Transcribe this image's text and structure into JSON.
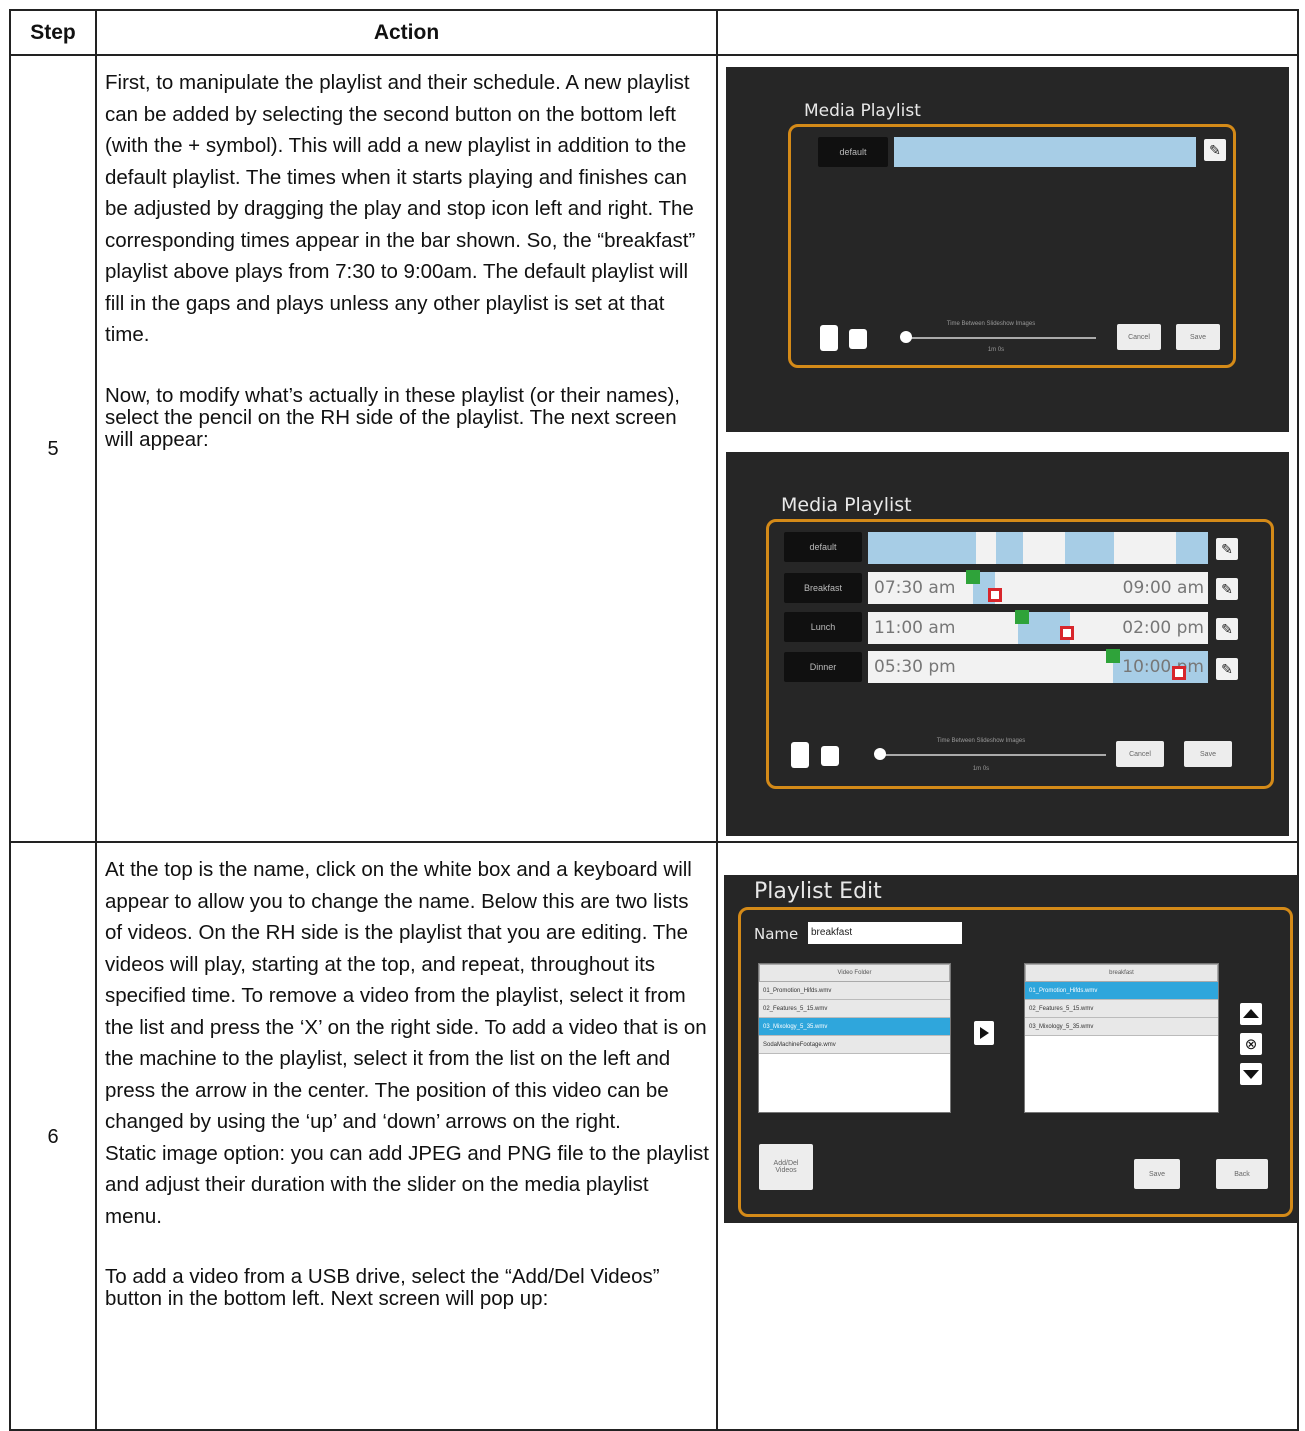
{
  "table": {
    "header": {
      "step": "Step",
      "action": "Action"
    },
    "rows": [
      {
        "step": "5",
        "paragraph1": "First, to manipulate the playlist and their schedule. A new playlist can be added by selecting the second button on the bottom left (with the + symbol). This will add a new playlist in addition to the default playlist. The times when it starts playing and finishes can be adjusted by dragging the play and stop icon left and right. The corresponding times appear in the bar shown. So, the “breakfast” playlist above plays from 7:30 to 9:00am. The default playlist will fill in the gaps and plays unless any other playlist is set at that time.",
        "paragraph2": "Now, to modify what’s actually in these playlist (or their names), select the pencil on the RH side of the playlist. The next screen will appear:"
      },
      {
        "step": "6",
        "paragraph1": "At the top is the name, click on the white box and a keyboard will appear to allow you to change the name. Below this are two lists of videos. On the RH side is the playlist that you are editing. The videos will play, starting at the top, and repeat, throughout its specified time. To remove a video from the playlist, select it from the list and press the ‘X’ on the right side. To add a video that is on the machine to the playlist, select it from the list on the left and press the arrow in the center. The position of this video can be changed by using the ‘up’ and ‘down’ arrows on the right.",
        "paragraph2": "Static image option: you can add JPEG and PNG file to the playlist and adjust their duration with the slider on the media playlist menu.",
        "paragraph3": "To add a video from a USB drive, select the “Add/Del Videos” button in the bottom left. Next screen will pop up:"
      }
    ]
  },
  "shot1": {
    "title": "Media Playlist",
    "default_label": "default",
    "slider_caption": "Time Between Slideshow Images",
    "slider_value": "1m 0s",
    "cancel": "Cancel",
    "save": "Save"
  },
  "shot2": {
    "title": "Media Playlist",
    "rows": [
      {
        "label": "default",
        "start": "",
        "end": ""
      },
      {
        "label": "Breakfast",
        "start": "07:30 am",
        "end": "09:00 am"
      },
      {
        "label": "Lunch",
        "start": "11:00 am",
        "end": "02:00 pm"
      },
      {
        "label": "Dinner",
        "start": "05:30 pm",
        "end": "10:00 pm"
      }
    ],
    "slider_caption": "Time Between Slideshow Images",
    "slider_value": "1m 0s",
    "cancel": "Cancel",
    "save": "Save"
  },
  "shot3": {
    "title": "Playlist Edit",
    "name_label": "Name",
    "name_value": "breakfast",
    "left_header": "Video Folder",
    "left_items": [
      "01_Promotion_Hifds.wmv",
      "02_Features_5_15.wmv",
      "03_Mixology_5_35.wmv",
      "SodaMachineFootage.wmv"
    ],
    "left_selected": 2,
    "right_header": "breakfast",
    "right_items": [
      "01_Promotion_Hifds.wmv",
      "02_Features_5_15.wmv",
      "03_Mixology_5_35.wmv"
    ],
    "right_selected": 0,
    "addel_label": "Add/Del Videos",
    "save": "Save",
    "back": "Back"
  },
  "colors": {
    "frame": "#d48a18",
    "screen_bg": "#262626",
    "bar_fill": "#a7cde6",
    "play_icon": "#2fa33a",
    "stop_icon": "#d8262c",
    "list_select": "#2fa6dc"
  }
}
